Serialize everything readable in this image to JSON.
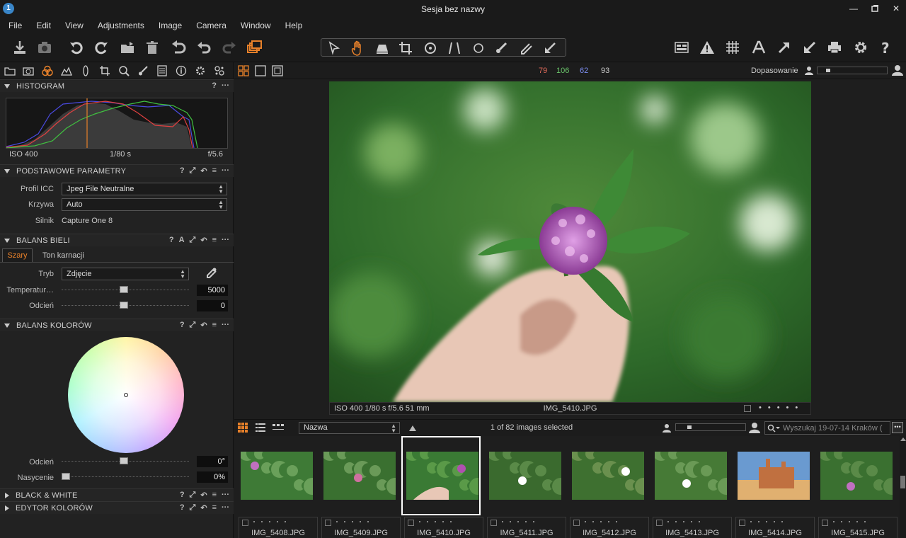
{
  "window": {
    "title": "Sesja bez nazwy"
  },
  "menu": [
    "File",
    "Edit",
    "View",
    "Adjustments",
    "Image",
    "Camera",
    "Window",
    "Help"
  ],
  "colors": {
    "accent": "#e8812a",
    "red_value": "#e06a5a",
    "green_value": "#6ac46a",
    "blue_value": "#7c8ef0"
  },
  "viewer_bar": {
    "rgb": {
      "r": "79",
      "g": "106",
      "b": "62",
      "a": "93"
    },
    "fit_label": "Dopasowanie"
  },
  "histogram": {
    "title": "HISTOGRAM",
    "iso": "ISO 400",
    "shutter": "1/80 s",
    "aperture": "f/5.6"
  },
  "basic": {
    "title": "PODSTAWOWE PARAMETRY",
    "icc_label": "Profil ICC",
    "icc_value": "Jpeg File Neutralne",
    "curve_label": "Krzywa",
    "curve_value": "Auto",
    "engine_label": "Silnik",
    "engine_value": "Capture One 8"
  },
  "wb": {
    "title": "BALANS BIELI",
    "tabs": [
      "Szary",
      "Ton karnacji"
    ],
    "mode_label": "Tryb",
    "mode_value": "Zdjęcie",
    "temp_label": "Temperatur…",
    "temp_value": "5000",
    "temp_level": 0.5,
    "tint_label": "Odcień",
    "tint_value": "0",
    "tint_level": 0.5
  },
  "color_balance": {
    "title": "BALANS KOLORÓW",
    "hue_label": "Odcień",
    "hue_value": "0°",
    "hue_level": 0.5,
    "sat_label": "Nasycenie",
    "sat_value": "0%",
    "sat_level": 0.0
  },
  "collapsed": {
    "bw": "BLACK & WHITE",
    "color_editor": "EDYTOR KOLORÓW"
  },
  "viewer": {
    "info": "ISO 400  1/80 s  f/5.6  51 mm",
    "filename": "IMG_5410.JPG"
  },
  "browser": {
    "sort_value": "Nazwa",
    "selection_text": "1 of 82 images selected",
    "search_placeholder": "Wyszukaj 19-07-14 Kraków (",
    "thumbs": [
      {
        "name": "IMG_5408.JPG",
        "selected": false
      },
      {
        "name": "IMG_5409.JPG",
        "selected": false
      },
      {
        "name": "IMG_5410.JPG",
        "selected": true
      },
      {
        "name": "IMG_5411.JPG",
        "selected": false
      },
      {
        "name": "IMG_5412.JPG",
        "selected": false
      },
      {
        "name": "IMG_5413.JPG",
        "selected": false
      },
      {
        "name": "IMG_5414.JPG",
        "selected": false
      },
      {
        "name": "IMG_5415.JPG",
        "selected": false
      }
    ]
  }
}
